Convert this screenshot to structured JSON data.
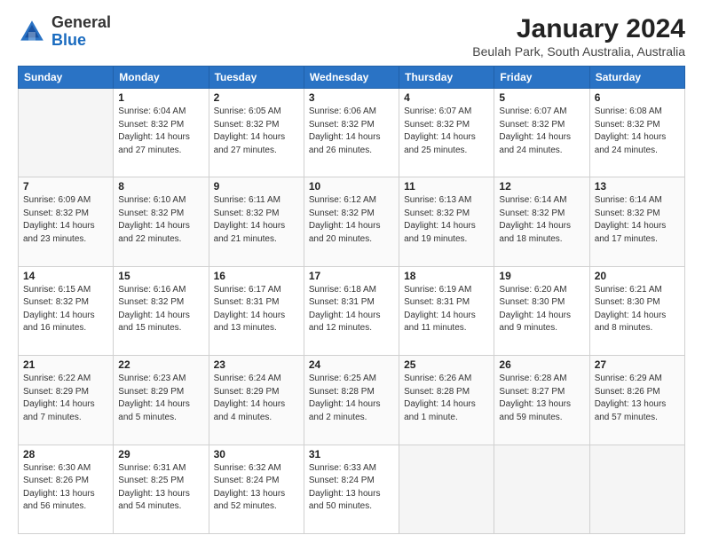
{
  "header": {
    "logo": {
      "general": "General",
      "blue": "Blue"
    },
    "title": "January 2024",
    "subtitle": "Beulah Park, South Australia, Australia"
  },
  "weekdays": [
    "Sunday",
    "Monday",
    "Tuesday",
    "Wednesday",
    "Thursday",
    "Friday",
    "Saturday"
  ],
  "weeks": [
    [
      {
        "day": "",
        "info": ""
      },
      {
        "day": "1",
        "info": "Sunrise: 6:04 AM\nSunset: 8:32 PM\nDaylight: 14 hours\nand 27 minutes."
      },
      {
        "day": "2",
        "info": "Sunrise: 6:05 AM\nSunset: 8:32 PM\nDaylight: 14 hours\nand 27 minutes."
      },
      {
        "day": "3",
        "info": "Sunrise: 6:06 AM\nSunset: 8:32 PM\nDaylight: 14 hours\nand 26 minutes."
      },
      {
        "day": "4",
        "info": "Sunrise: 6:07 AM\nSunset: 8:32 PM\nDaylight: 14 hours\nand 25 minutes."
      },
      {
        "day": "5",
        "info": "Sunrise: 6:07 AM\nSunset: 8:32 PM\nDaylight: 14 hours\nand 24 minutes."
      },
      {
        "day": "6",
        "info": "Sunrise: 6:08 AM\nSunset: 8:32 PM\nDaylight: 14 hours\nand 24 minutes."
      }
    ],
    [
      {
        "day": "7",
        "info": "Sunrise: 6:09 AM\nSunset: 8:32 PM\nDaylight: 14 hours\nand 23 minutes."
      },
      {
        "day": "8",
        "info": "Sunrise: 6:10 AM\nSunset: 8:32 PM\nDaylight: 14 hours\nand 22 minutes."
      },
      {
        "day": "9",
        "info": "Sunrise: 6:11 AM\nSunset: 8:32 PM\nDaylight: 14 hours\nand 21 minutes."
      },
      {
        "day": "10",
        "info": "Sunrise: 6:12 AM\nSunset: 8:32 PM\nDaylight: 14 hours\nand 20 minutes."
      },
      {
        "day": "11",
        "info": "Sunrise: 6:13 AM\nSunset: 8:32 PM\nDaylight: 14 hours\nand 19 minutes."
      },
      {
        "day": "12",
        "info": "Sunrise: 6:14 AM\nSunset: 8:32 PM\nDaylight: 14 hours\nand 18 minutes."
      },
      {
        "day": "13",
        "info": "Sunrise: 6:14 AM\nSunset: 8:32 PM\nDaylight: 14 hours\nand 17 minutes."
      }
    ],
    [
      {
        "day": "14",
        "info": "Sunrise: 6:15 AM\nSunset: 8:32 PM\nDaylight: 14 hours\nand 16 minutes."
      },
      {
        "day": "15",
        "info": "Sunrise: 6:16 AM\nSunset: 8:32 PM\nDaylight: 14 hours\nand 15 minutes."
      },
      {
        "day": "16",
        "info": "Sunrise: 6:17 AM\nSunset: 8:31 PM\nDaylight: 14 hours\nand 13 minutes."
      },
      {
        "day": "17",
        "info": "Sunrise: 6:18 AM\nSunset: 8:31 PM\nDaylight: 14 hours\nand 12 minutes."
      },
      {
        "day": "18",
        "info": "Sunrise: 6:19 AM\nSunset: 8:31 PM\nDaylight: 14 hours\nand 11 minutes."
      },
      {
        "day": "19",
        "info": "Sunrise: 6:20 AM\nSunset: 8:30 PM\nDaylight: 14 hours\nand 9 minutes."
      },
      {
        "day": "20",
        "info": "Sunrise: 6:21 AM\nSunset: 8:30 PM\nDaylight: 14 hours\nand 8 minutes."
      }
    ],
    [
      {
        "day": "21",
        "info": "Sunrise: 6:22 AM\nSunset: 8:29 PM\nDaylight: 14 hours\nand 7 minutes."
      },
      {
        "day": "22",
        "info": "Sunrise: 6:23 AM\nSunset: 8:29 PM\nDaylight: 14 hours\nand 5 minutes."
      },
      {
        "day": "23",
        "info": "Sunrise: 6:24 AM\nSunset: 8:29 PM\nDaylight: 14 hours\nand 4 minutes."
      },
      {
        "day": "24",
        "info": "Sunrise: 6:25 AM\nSunset: 8:28 PM\nDaylight: 14 hours\nand 2 minutes."
      },
      {
        "day": "25",
        "info": "Sunrise: 6:26 AM\nSunset: 8:28 PM\nDaylight: 14 hours\nand 1 minute."
      },
      {
        "day": "26",
        "info": "Sunrise: 6:28 AM\nSunset: 8:27 PM\nDaylight: 13 hours\nand 59 minutes."
      },
      {
        "day": "27",
        "info": "Sunrise: 6:29 AM\nSunset: 8:26 PM\nDaylight: 13 hours\nand 57 minutes."
      }
    ],
    [
      {
        "day": "28",
        "info": "Sunrise: 6:30 AM\nSunset: 8:26 PM\nDaylight: 13 hours\nand 56 minutes."
      },
      {
        "day": "29",
        "info": "Sunrise: 6:31 AM\nSunset: 8:25 PM\nDaylight: 13 hours\nand 54 minutes."
      },
      {
        "day": "30",
        "info": "Sunrise: 6:32 AM\nSunset: 8:24 PM\nDaylight: 13 hours\nand 52 minutes."
      },
      {
        "day": "31",
        "info": "Sunrise: 6:33 AM\nSunset: 8:24 PM\nDaylight: 13 hours\nand 50 minutes."
      },
      {
        "day": "",
        "info": ""
      },
      {
        "day": "",
        "info": ""
      },
      {
        "day": "",
        "info": ""
      }
    ]
  ]
}
